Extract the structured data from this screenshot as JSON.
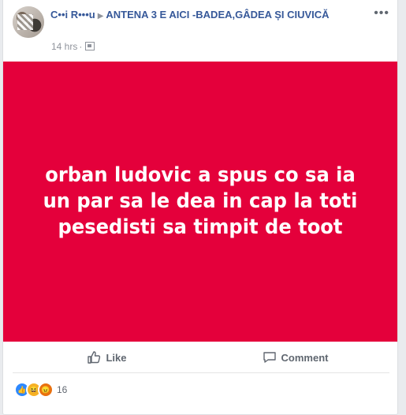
{
  "post": {
    "author": "C••i R•••u",
    "group": "ANTENA 3 E AICI -BADEA,GÂDEA ȘI CIUVICĂ",
    "time": "14 hrs",
    "text": "orban ludovic a spus co sa ia un par sa le dea in cap la toti pesedisti sa timpit de toot",
    "background_color": "#e4003b"
  },
  "actions": {
    "like": "Like",
    "comment": "Comment"
  },
  "reactions": {
    "icons": [
      "like-icon",
      "haha-icon",
      "angry-icon"
    ],
    "count": "16"
  }
}
